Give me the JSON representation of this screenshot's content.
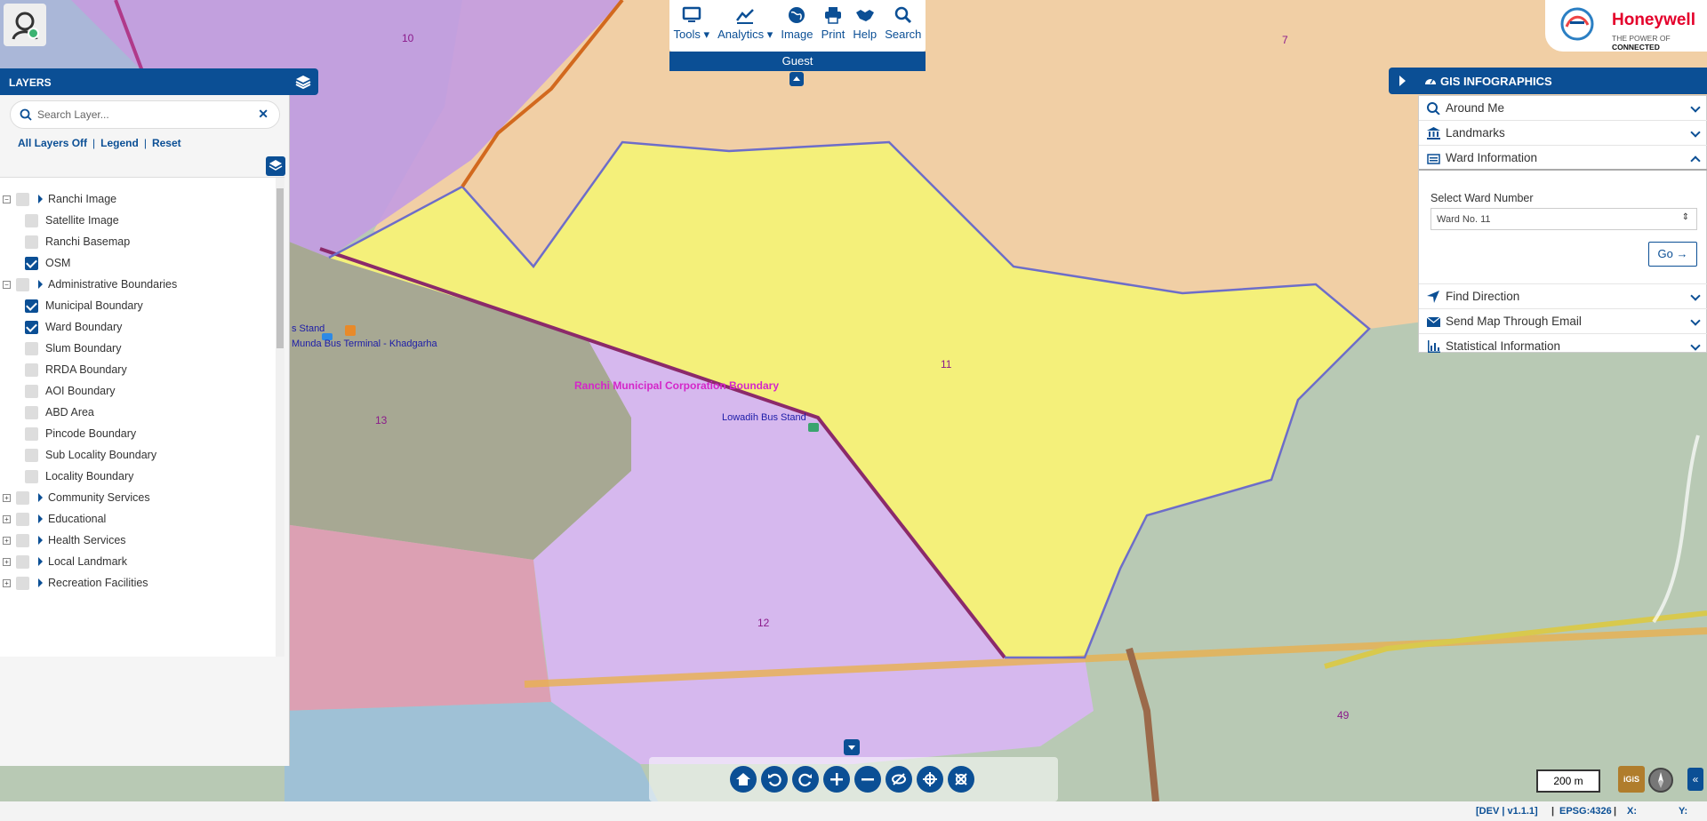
{
  "map": {
    "ward_labels": [
      "10",
      "7",
      "11",
      "13",
      "12",
      "49"
    ],
    "place_labels": {
      "boundary": "Ranchi Municipal Corporation Boundary",
      "bus_stand": "Lowadih Bus Stand",
      "bus_terminal": "Munda Bus Terminal - Khadgarha",
      "stand_partial": "s Stand"
    }
  },
  "layers": {
    "title": "LAYERS",
    "search_placeholder": "Search Layer...",
    "links": {
      "all_off": "All Layers Off",
      "legend": "Legend",
      "reset": "Reset"
    },
    "tree": [
      {
        "label": "Ranchi Image",
        "group": true,
        "checked": false
      },
      {
        "label": "Satellite Image",
        "group": false,
        "checked": false
      },
      {
        "label": "Ranchi Basemap",
        "group": false,
        "checked": false
      },
      {
        "label": "OSM",
        "group": false,
        "checked": true
      },
      {
        "label": "Administrative Boundaries",
        "group": true,
        "checked": false
      },
      {
        "label": "Municipal Boundary",
        "group": false,
        "checked": true
      },
      {
        "label": "Ward Boundary",
        "group": false,
        "checked": true
      },
      {
        "label": "Slum Boundary",
        "group": false,
        "checked": false
      },
      {
        "label": "RRDA Boundary",
        "group": false,
        "checked": false
      },
      {
        "label": "AOI Boundary",
        "group": false,
        "checked": false
      },
      {
        "label": "ABD Area",
        "group": false,
        "checked": false
      },
      {
        "label": "Pincode Boundary",
        "group": false,
        "checked": false
      },
      {
        "label": "Sub Locality Boundary",
        "group": false,
        "checked": false
      },
      {
        "label": "Locality Boundary",
        "group": false,
        "checked": false
      },
      {
        "label": "Community Services",
        "group": true,
        "checked": false
      },
      {
        "label": "Educational",
        "group": true,
        "checked": false
      },
      {
        "label": "Health Services",
        "group": true,
        "checked": false
      },
      {
        "label": "Local Landmark",
        "group": true,
        "checked": false
      },
      {
        "label": "Recreation Facilities",
        "group": true,
        "checked": false
      }
    ]
  },
  "toolbar": {
    "items": [
      "Tools",
      "Analytics",
      "Image",
      "Print",
      "Help",
      "Search"
    ],
    "user": "Guest"
  },
  "brand": {
    "name": "Honeywell",
    "tagline_a": "THE POWER OF ",
    "tagline_b": "CONNECTED"
  },
  "info": {
    "title": "GIS INFOGRAPHICS",
    "rows": [
      "Around Me",
      "Landmarks",
      "Ward Information"
    ],
    "ward_label": "Select Ward Number",
    "ward_value": "Ward No. 11",
    "go": "Go",
    "rows_bottom": [
      "Find Direction",
      "Send Map Through Email",
      "Statistical Information"
    ]
  },
  "scale": "200 m",
  "status": {
    "version": "[DEV | v1.1.1]",
    "epsg": "EPSG:4326",
    "x": "X:",
    "y": "Y:"
  },
  "colors": {
    "primary": "#0b4f95",
    "ward11": "#f4f07a",
    "ward12": "#d6b8ee",
    "ward7": "#f1cfa5",
    "ward13": "#a7a893"
  }
}
